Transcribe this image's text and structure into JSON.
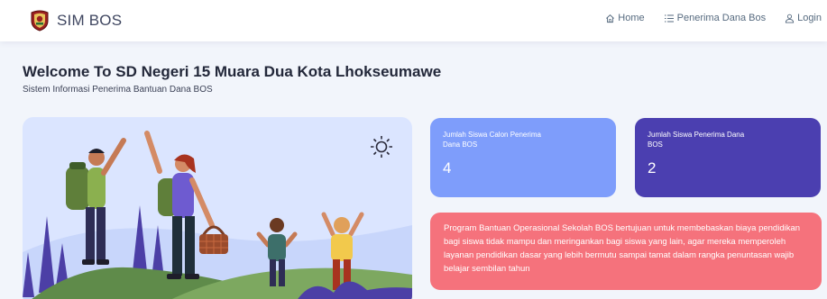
{
  "nav": {
    "brand_name": "SIM BOS",
    "home_label": "Home",
    "penerima_label": "Penerima Dana Bos",
    "login_label": "Login"
  },
  "welcome": {
    "title": "Welcome To SD Negeri 15 Muara Dua Kota Lhokseumawe",
    "subtitle": "Sistem Informasi Penerima Bantuan Dana BOS"
  },
  "stats": [
    {
      "label": "Jumlah Siswa Calon Penerima Dana BOS",
      "value": "4"
    },
    {
      "label": "Jumlah Siswa Penerima Dana BOS",
      "value": "2"
    }
  ],
  "info": {
    "text": "Program Bantuan Operasional Sekolah BOS bertujuan untuk membebaskan biaya pendidikan bagi siswa tidak mampu dan meringankan bagi siswa yang lain, agar mereka memperoleh layanan pendidikan dasar yang lebih bermutu sampai tamat dalam rangka penuntasan wajib belajar sembilan tahun"
  },
  "colors": {
    "card_1": "#7e9dfb",
    "card_2": "#4b3fb0",
    "info_card": "#f5727c",
    "hero_bg": "#dbe5ff"
  },
  "icons": {
    "brand": "school-crest-icon",
    "home": "home-icon",
    "penerima": "list-icon",
    "login": "user-icon",
    "hero_weather": "sun-icon"
  }
}
